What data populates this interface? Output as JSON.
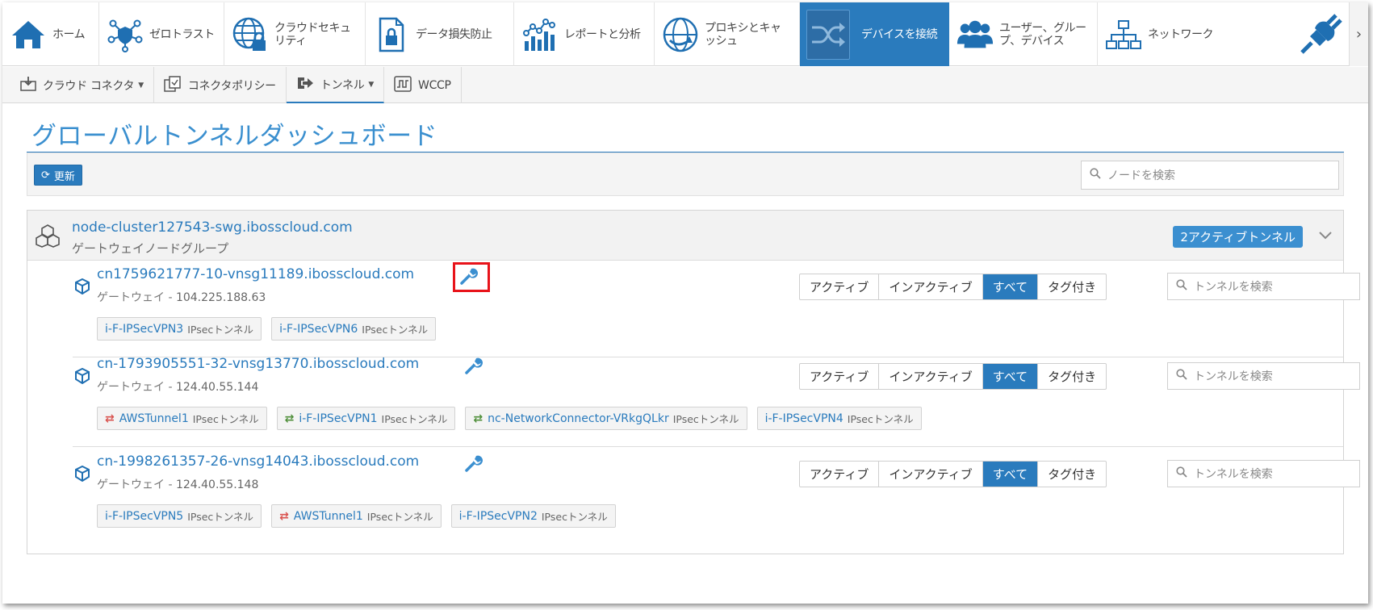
{
  "topnav": {
    "items": [
      {
        "label": "ホーム",
        "icon": "home-icon"
      },
      {
        "label": "ゼロトラスト",
        "icon": "zero-trust-icon"
      },
      {
        "label": "クラウドセキュリティ",
        "icon": "cloud-security-globe-icon"
      },
      {
        "label": "データ損失防止",
        "icon": "dlp-document-lock-icon"
      },
      {
        "label": "レポートと分析",
        "icon": "reports-chart-icon"
      },
      {
        "label": "プロキシとキャッシュ",
        "icon": "proxy-globe-icon"
      },
      {
        "label": "デバイスを接続",
        "icon": "connect-devices-shuffle-icon"
      },
      {
        "label": "ユーザー、グループ、デバイス",
        "icon": "users-group-icon"
      },
      {
        "label": "ネットワーク",
        "icon": "network-tree-icon"
      }
    ],
    "more": "›"
  },
  "subnav": {
    "items": [
      {
        "label": "クラウド コネクタ",
        "icon": "cloud-connector-download-icon",
        "dropdown": true
      },
      {
        "label": "コネクタポリシー",
        "icon": "connector-policy-icon",
        "dropdown": false
      },
      {
        "label": "トンネル",
        "icon": "tunnel-arrow-icon",
        "dropdown": true
      },
      {
        "label": "WCCP",
        "icon": "wccp-wave-icon",
        "dropdown": false
      }
    ]
  },
  "page": {
    "title": "グローバルトンネルダッシュボード",
    "refresh_label": "更新",
    "node_search_placeholder": "ノードを検索"
  },
  "cluster": {
    "name": "node-cluster127543-swg.ibosscloud.com",
    "subtitle": "ゲートウェイノードグループ",
    "badge": "2アクティブトンネル"
  },
  "filters": [
    "アクティブ",
    "インアクティブ",
    "すべて",
    "タグ付き"
  ],
  "selected_filter": "すべて",
  "tunnel_search_placeholder": "トンネルを検索",
  "gateways": [
    {
      "name": "cn1759621777-10-vnsg11189.ibosscloud.com",
      "type": "ゲートウェイ",
      "ip": "104.225.188.63",
      "tunnels": [
        {
          "name": "i-F-IPSecVPN3",
          "kind": "IPsecトンネル",
          "status": "none"
        },
        {
          "name": "i-F-IPSecVPN6",
          "kind": "IPsecトンネル",
          "status": "none"
        }
      ]
    },
    {
      "name": "cn-1793905551-32-vnsg13770.ibosscloud.com",
      "type": "ゲートウェイ",
      "ip": "124.40.55.144",
      "tunnels": [
        {
          "name": "AWSTunnel1",
          "kind": "IPsecトンネル",
          "status": "red"
        },
        {
          "name": "i-F-IPSecVPN1",
          "kind": "IPsecトンネル",
          "status": "green"
        },
        {
          "name": "nc-NetworkConnector-VRkgQLkr",
          "kind": "IPsecトンネル",
          "status": "green"
        },
        {
          "name": "i-F-IPSecVPN4",
          "kind": "IPsecトンネル",
          "status": "none"
        }
      ]
    },
    {
      "name": "cn-1998261357-26-vnsg14043.ibosscloud.com",
      "type": "ゲートウェイ",
      "ip": "124.40.55.148",
      "tunnels": [
        {
          "name": "i-F-IPSecVPN5",
          "kind": "IPsecトンネル",
          "status": "none"
        },
        {
          "name": "AWSTunnel1",
          "kind": "IPsecトンネル",
          "status": "red"
        },
        {
          "name": "i-F-IPSecVPN2",
          "kind": "IPsecトンネル",
          "status": "none"
        }
      ]
    }
  ],
  "colors": {
    "accent": "#2a7bbd",
    "title": "#3a8fcf",
    "inactive_arrow": "#d9534f",
    "active_arrow": "#4f8f3a",
    "highlight": "#e8131a"
  }
}
